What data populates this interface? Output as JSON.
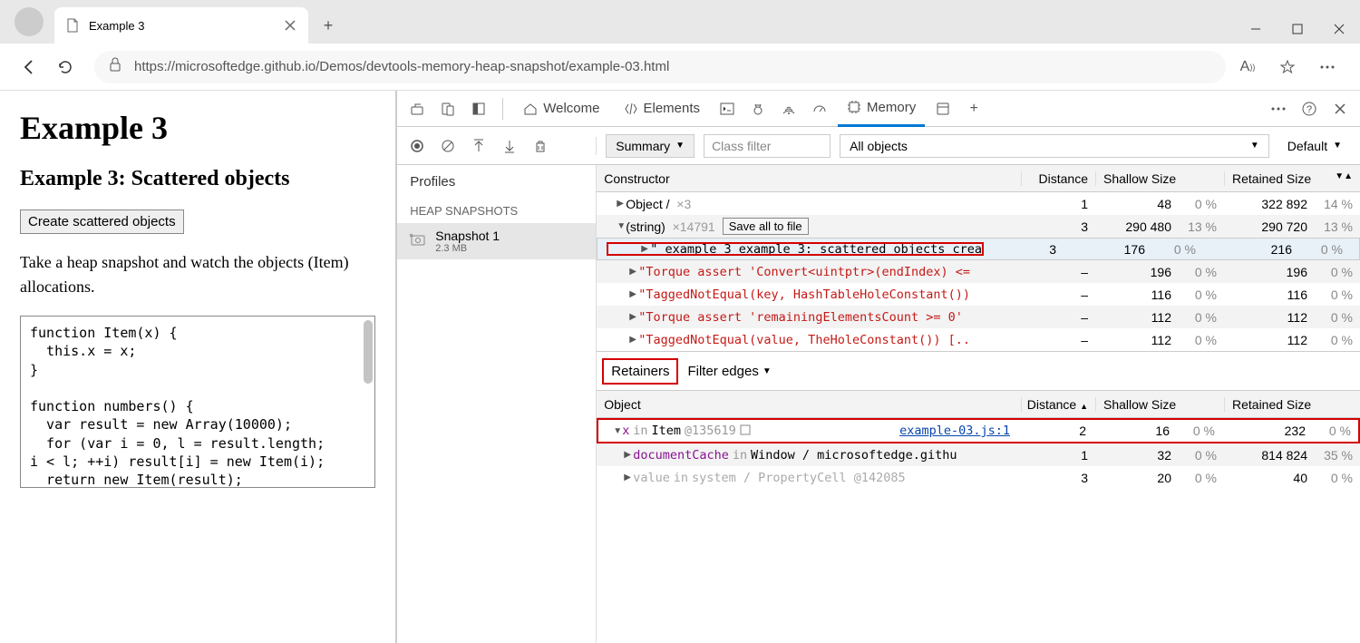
{
  "window": {
    "tab_title": "Example 3",
    "url": "https://microsoftedge.github.io/Demos/devtools-memory-heap-snapshot/example-03.html"
  },
  "page": {
    "h1": "Example 3",
    "h2": "Example 3: Scattered objects",
    "button": "Create scattered objects",
    "paragraph": "Take a heap snapshot and watch the objects (Item) allocations.",
    "code": "function Item(x) {\n  this.x = x;\n}\n\nfunction numbers() {\n  var result = new Array(10000);\n  for (var i = 0, l = result.length;\ni < l; ++i) result[i] = new Item(i);\n  return new Item(result);"
  },
  "devtools": {
    "tabs": {
      "welcome": "Welcome",
      "elements": "Elements",
      "memory": "Memory"
    },
    "toolbar": {
      "summary": "Summary",
      "classfilter_ph": "Class filter",
      "allobjects": "All objects",
      "default": "Default"
    },
    "side": {
      "profiles": "Profiles",
      "heap": "HEAP SNAPSHOTS",
      "snap_name": "Snapshot 1",
      "snap_size": "2.3 MB"
    },
    "headers": {
      "constructor": "Constructor",
      "distance": "Distance",
      "shallow": "Shallow Size",
      "retained": "Retained Size",
      "object": "Object"
    },
    "saveall": "Save all to file",
    "rows": {
      "r0": {
        "txt": "Object /",
        "count": "×3",
        "d": "1",
        "ss": "48",
        "sp": "0 %",
        "rs": "322 892",
        "rp": "14 %"
      },
      "r1": {
        "txt": "(string)",
        "count": "×14791",
        "d": "3",
        "ss": "290 480",
        "sp": "13 %",
        "rs": "290 720",
        "rp": "13 %"
      },
      "r2": {
        "txt": "\"  example 3 example 3: scattered objects crea",
        "d": "3",
        "ss": "176",
        "sp": "0 %",
        "rs": "216",
        "rp": "0 %"
      },
      "r3": {
        "txt": "\"Torque assert 'Convert<uintptr>(endIndex) <=",
        "d": "–",
        "ss": "196",
        "sp": "0 %",
        "rs": "196",
        "rp": "0 %"
      },
      "r4": {
        "txt": "\"TaggedNotEqual(key, HashTableHoleConstant())",
        "d": "–",
        "ss": "116",
        "sp": "0 %",
        "rs": "116",
        "rp": "0 %"
      },
      "r5": {
        "txt": "\"Torque assert 'remainingElementsCount >= 0'",
        "d": "–",
        "ss": "112",
        "sp": "0 %",
        "rs": "112",
        "rp": "0 %"
      },
      "r6": {
        "txt": "\"TaggedNotEqual(value, TheHoleConstant()) [..",
        "d": "–",
        "ss": "112",
        "sp": "0 %",
        "rs": "112",
        "rp": "0 %"
      }
    },
    "mid": {
      "retainers": "Retainers",
      "filteredges": "Filter edges"
    },
    "ret": {
      "r0": {
        "p1": "x",
        "p2": "in",
        "p3": "Item",
        "p4": "@135619",
        "link": "example-03.js:1",
        "d": "2",
        "ss": "16",
        "sp": "0 %",
        "rs": "232",
        "rp": "0 %"
      },
      "r1": {
        "p1": "documentCache",
        "p2": "in",
        "p3": "Window / microsoftedge.githu",
        "d": "1",
        "ss": "32",
        "sp": "0 %",
        "rs": "814 824",
        "rp": "35 %"
      },
      "r2": {
        "p1": "value",
        "p2": "in",
        "p3": "system / PropertyCell @142085",
        "d": "3",
        "ss": "20",
        "sp": "0 %",
        "rs": "40",
        "rp": "0 %"
      }
    }
  }
}
